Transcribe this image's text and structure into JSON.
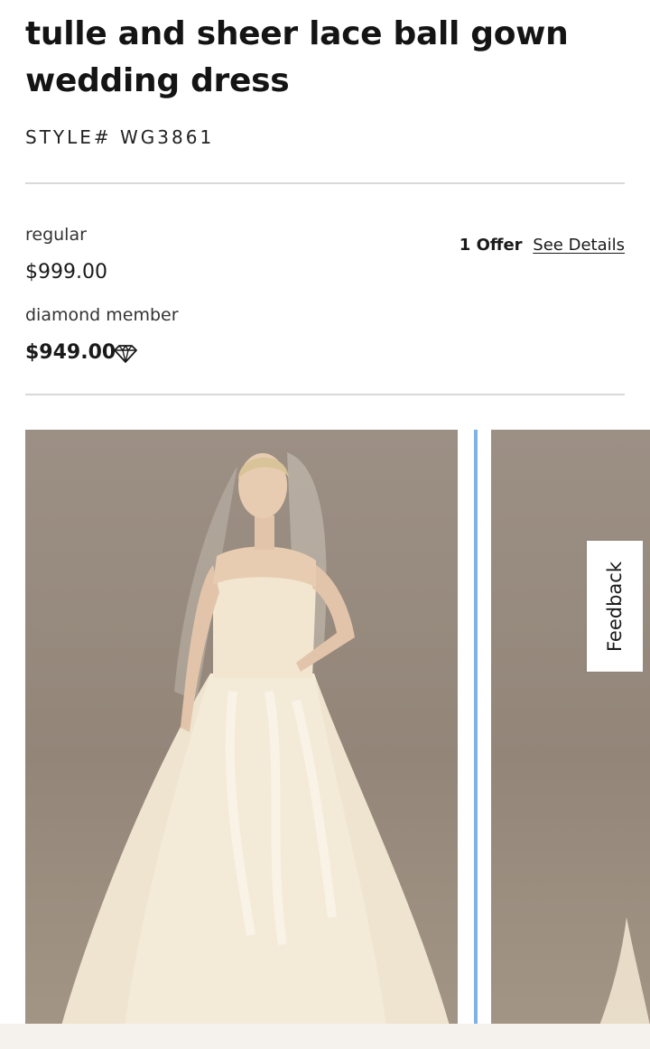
{
  "product": {
    "title": "tulle and sheer lace ball gown wedding dress",
    "style_number": "STYLE# WG3861"
  },
  "pricing": {
    "regular_label": "regular",
    "regular_price": "$999.00",
    "member_label": "diamond member",
    "member_price": "$949.00",
    "member_icon": "diamond-icon"
  },
  "offers": {
    "count_label": "1 Offer",
    "details_link": "See Details"
  },
  "gallery": {
    "images": [
      {
        "alt": "Model wearing strapless ivory lace ball gown with veil",
        "active": true
      },
      {
        "alt": "Alternate product view",
        "active": false
      }
    ],
    "indicator_color": "#7fb2e5",
    "backdrop_color": "#9c8f84"
  },
  "feedback": {
    "label": "Feedback"
  }
}
